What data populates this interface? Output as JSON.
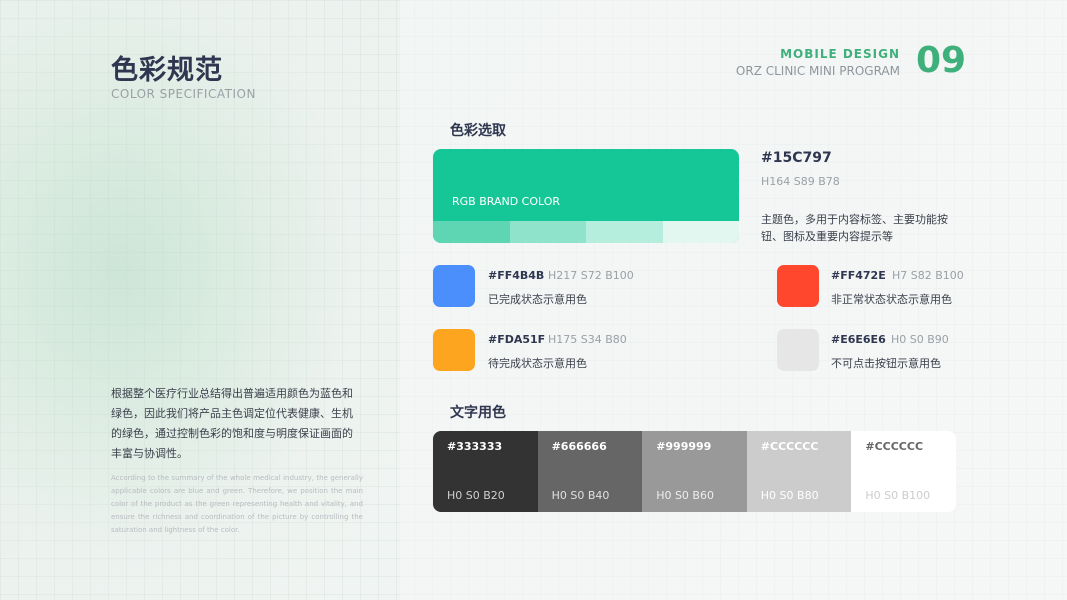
{
  "header": {
    "title": "色彩规范",
    "subtitle": "COLOR  SPECIFICATION",
    "brand_line": "MOBILE  DESIGN",
    "program_line": "ORZ CLINIC  MINI PROGRAM",
    "page_number": "09"
  },
  "color_picker": {
    "section_title": "色彩选取",
    "brand": {
      "label": "RGB BRAND COLOR",
      "hex": "#15C797",
      "hsb": "H164 S89 B78",
      "description": "主题色，多用于内容标签、主要功能按钮、图标及重要内容提示等",
      "color": "#15C797",
      "tints": [
        "#5fd6b3",
        "#8ee3ca",
        "#b5eedd",
        "#e2f7f0"
      ]
    },
    "swatches": [
      {
        "hex": "#FF4B4B",
        "hsb": "H217 S72 B100",
        "description": "已完成状态示意用色",
        "color": "#4b8ffd"
      },
      {
        "hex": "#FF472E",
        "hsb": "H7 S82 B100",
        "description": "非正常状态状态示意用色",
        "color": "#ff472e"
      },
      {
        "hex": "#FDA51F",
        "hsb": "H175 S34 B80",
        "description": "待完成状态示意用色",
        "color": "#fda51f"
      },
      {
        "hex": "#E6E6E6",
        "hsb": "H0 S0 B90",
        "description": "不可点击按钮示意用色",
        "color": "#e6e6e6"
      }
    ]
  },
  "intro": {
    "cn": "根据整个医疗行业总结得出普遍适用颜色为蓝色和绿色，因此我们将产品主色调定位代表健康、生机的绿色，通过控制色彩的饱和度与明度保证画面的丰富与协调性。",
    "en": "According to the summary of the whole medical industry, the generally applicable colors are blue and green. Therefore, we position the main color of the product as the green representing health and vitality, and ensure the richness and coordination of the picture by controlling the saturation and lightness of the color."
  },
  "text_colors": {
    "section_title": "文字用色",
    "items": [
      {
        "hex": "#333333",
        "hsb": "H0 S0 B20",
        "color": "#333333",
        "text_color": "#ffffff",
        "hsb_color": "#d0d0d0"
      },
      {
        "hex": "#666666",
        "hsb": "H0 S0 B40",
        "color": "#666666",
        "text_color": "#ffffff",
        "hsb_color": "#e0e0e0"
      },
      {
        "hex": "#999999",
        "hsb": "H0 S0 B60",
        "color": "#999999",
        "text_color": "#ffffff",
        "hsb_color": "#eeeeee"
      },
      {
        "hex": "#CCCCCC",
        "hsb": "H0 S0 B80",
        "color": "#cccccc",
        "text_color": "#ffffff",
        "hsb_color": "#ffffff"
      },
      {
        "hex": "#CCCCCC",
        "hsb": "H0 S0 B100",
        "color": "#ffffff",
        "text_color": "#666666",
        "hsb_color": "#cccccc"
      }
    ]
  }
}
